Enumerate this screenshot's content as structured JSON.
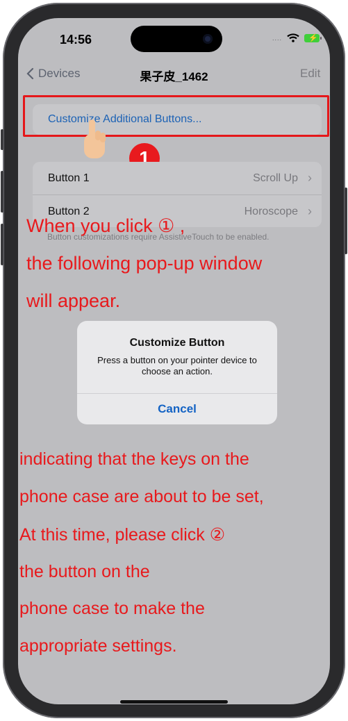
{
  "status": {
    "time": "14:56",
    "signal_dots": "....",
    "wifi_icon": "wifi-icon",
    "battery_icon": "battery-charging-icon"
  },
  "nav": {
    "back_label": "Devices",
    "title": "果子皮_1462",
    "edit_label": "Edit"
  },
  "customize_cell": {
    "label": "Customize Additional Buttons..."
  },
  "step_badge": "1",
  "buttons": [
    {
      "label": "Button 1",
      "value": "Scroll Up"
    },
    {
      "label": "Button 2",
      "value": "Horoscope"
    }
  ],
  "footer_note": "Button customizations require AssistiveTouch to be enabled.",
  "annotation_top": [
    "When you click ① ,",
    "the following pop-up window",
    "will appear."
  ],
  "dialog": {
    "title": "Customize Button",
    "message": "Press a button on your pointer device to choose an action.",
    "cancel_label": "Cancel"
  },
  "annotation_bottom": [
    "indicating that the keys on the",
    "phone case are about to be set,",
    "At this time, please click ②",
    "the  button on the",
    "phone case to make the",
    "appropriate settings."
  ],
  "colors": {
    "annotation_red": "#e8191c",
    "ios_blue": "#1463c4",
    "highlight_red": "#e5171a"
  }
}
